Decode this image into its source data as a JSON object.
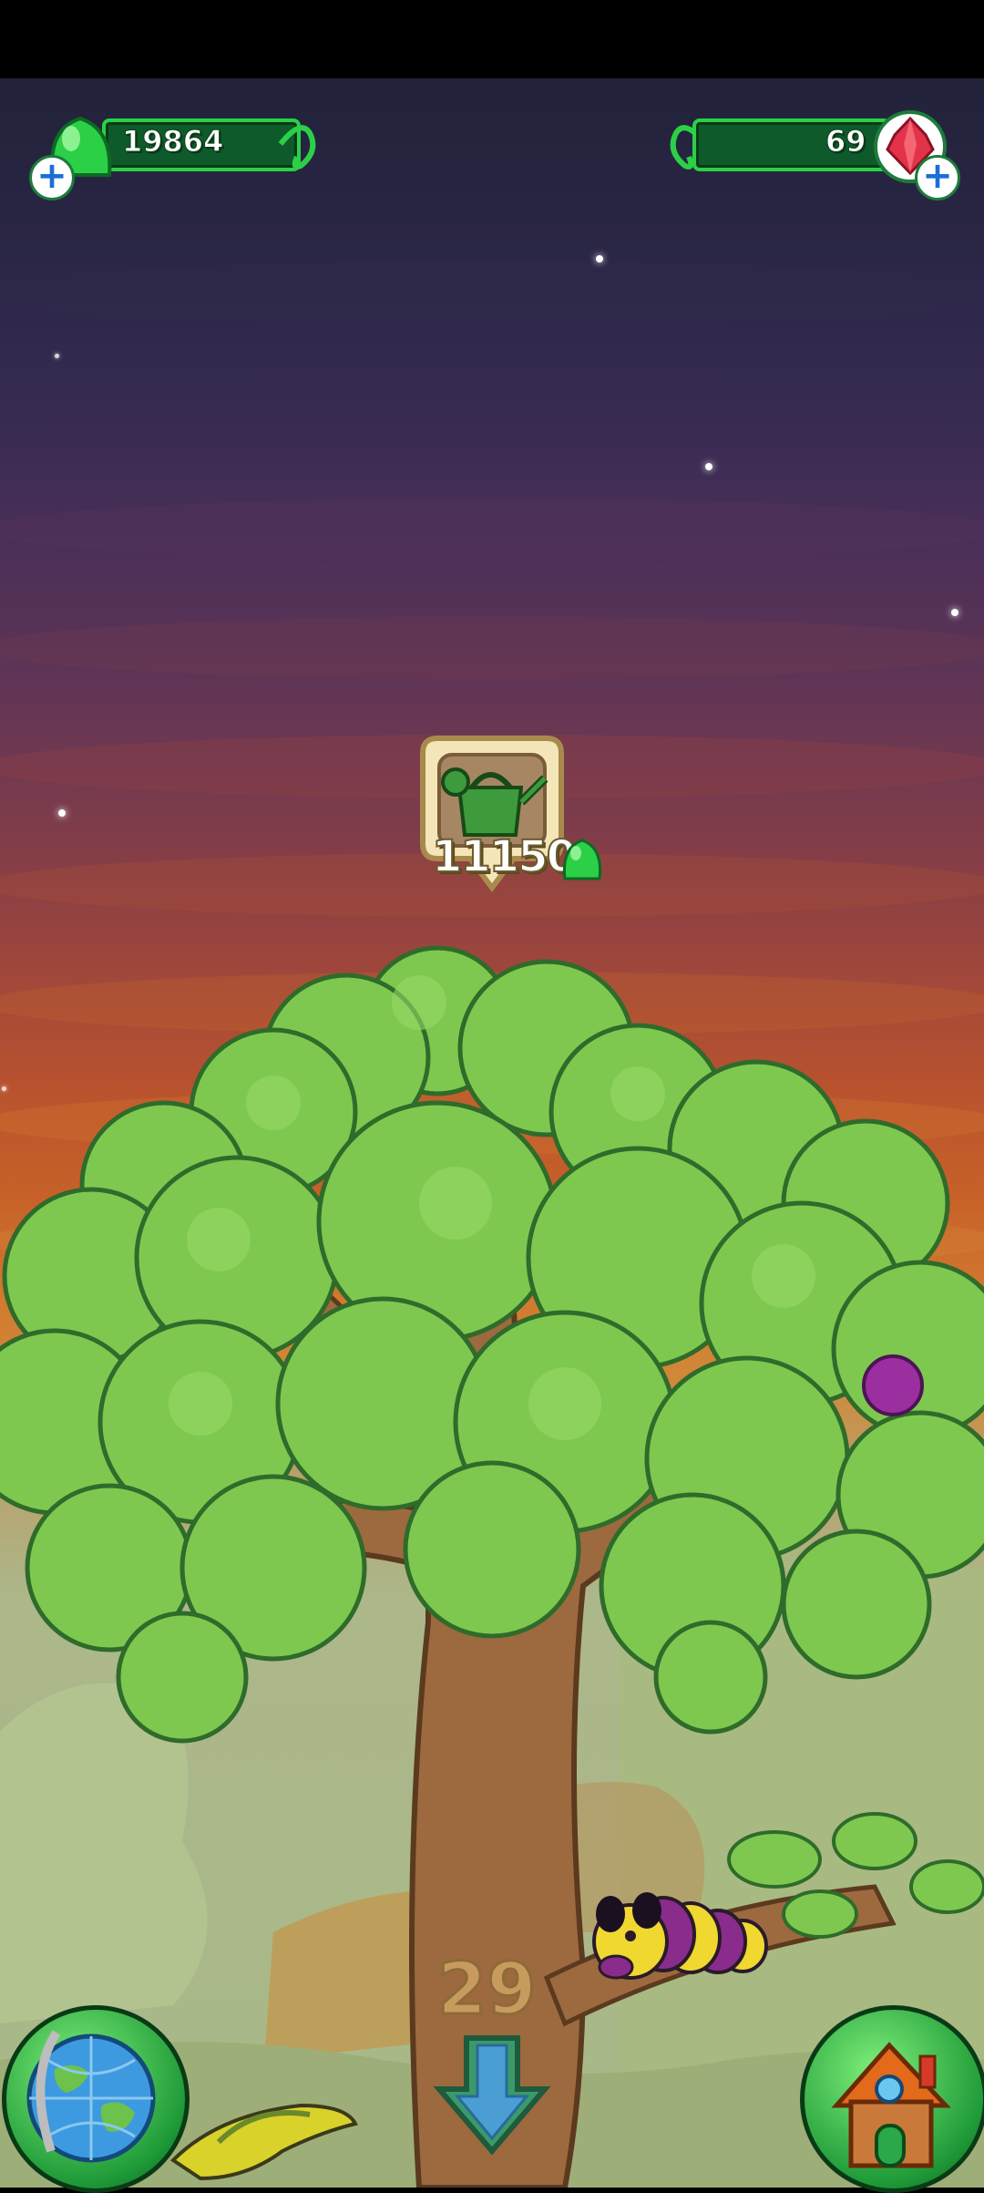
{
  "hud": {
    "jelly_count": "19864",
    "gem_count": "69"
  },
  "item_marker": {
    "icon": "watering-can-icon",
    "cost": "11150",
    "currency_icon": "jelly-icon"
  },
  "level": {
    "number": "29"
  },
  "buttons": {
    "world_map_icon": "globe-icon",
    "scroll_down_icon": "down-arrow-icon",
    "home_icon": "house-icon"
  },
  "colors": {
    "hud_bar": "#0f5a2a",
    "hud_border": "#2bd047",
    "leaf": "#7ec850",
    "trunk": "#9c6a3e"
  }
}
